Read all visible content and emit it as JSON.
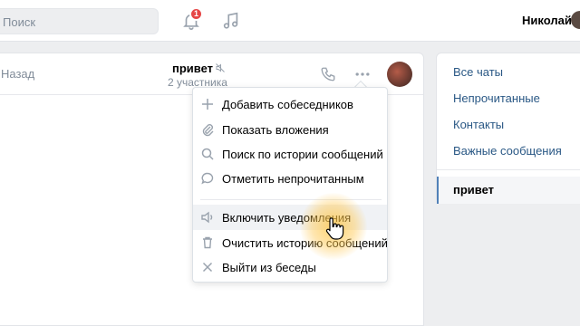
{
  "header": {
    "search_placeholder": "Поиск",
    "notifications_count": "1",
    "user_name": "Николай"
  },
  "chat": {
    "back_label": "Назад",
    "title": "привет",
    "subtitle": "2 участника"
  },
  "menu": {
    "items": [
      {
        "label": "Добавить собеседников",
        "icon": "plus-icon"
      },
      {
        "label": "Показать вложения",
        "icon": "paperclip-icon"
      },
      {
        "label": "Поиск по истории сообщений",
        "icon": "search-icon"
      },
      {
        "label": "Отметить непрочитанным",
        "icon": "speech-bubble-icon"
      },
      {
        "label": "Включить уведомления",
        "icon": "speaker-icon"
      },
      {
        "label": "Очистить историю сообщений",
        "icon": "trash-icon"
      },
      {
        "label": "Выйти из беседы",
        "icon": "close-icon"
      }
    ]
  },
  "sidebar": {
    "folders": [
      "Все чаты",
      "Непрочитанные",
      "Контакты",
      "Важные сообщения"
    ],
    "active_chat": "привет"
  },
  "colors": {
    "accent": "#2a5885",
    "badge": "#e64646",
    "hover_highlight": "#ffc43c"
  }
}
